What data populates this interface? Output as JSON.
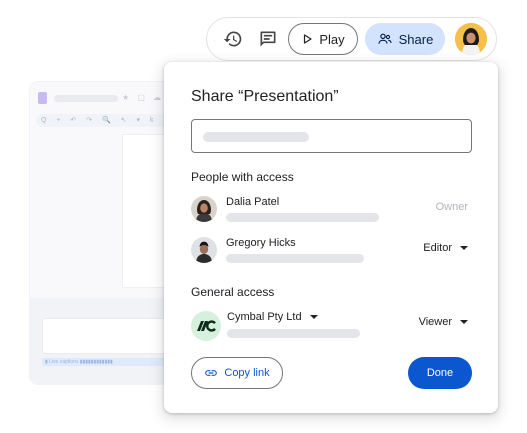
{
  "background_app": {
    "mini_icons": "★ ▢ ☁",
    "toolbar_glyphs": "Q + ↶ ↷ 🔍 ↖ ▾ k ▤ ¶",
    "caption_text": "▮ Live captions ▮▮▮▮▮▮▮▮▮▮▮▮"
  },
  "toolbar": {
    "history_icon": "history-icon",
    "comments_icon": "comments-icon",
    "play_label": "Play",
    "share_label": "Share"
  },
  "dialog": {
    "title": "Share “Presentation”",
    "add_people_placeholder": "",
    "people_heading": "People with access",
    "people": [
      {
        "name": "Dalia Patel",
        "role": "Owner"
      },
      {
        "name": "Gregory Hicks",
        "role": "Editor"
      }
    ],
    "general_heading": "General access",
    "general": {
      "org": "Cymbal Pty Ltd",
      "role": "Viewer"
    },
    "copy_link_label": "Copy link",
    "done_label": "Done"
  },
  "colors": {
    "accent": "#0b57d0",
    "share_bg": "#d3e3fd",
    "cymbal_bg": "#d6f0de",
    "placeholder": "#e3e5e8"
  }
}
